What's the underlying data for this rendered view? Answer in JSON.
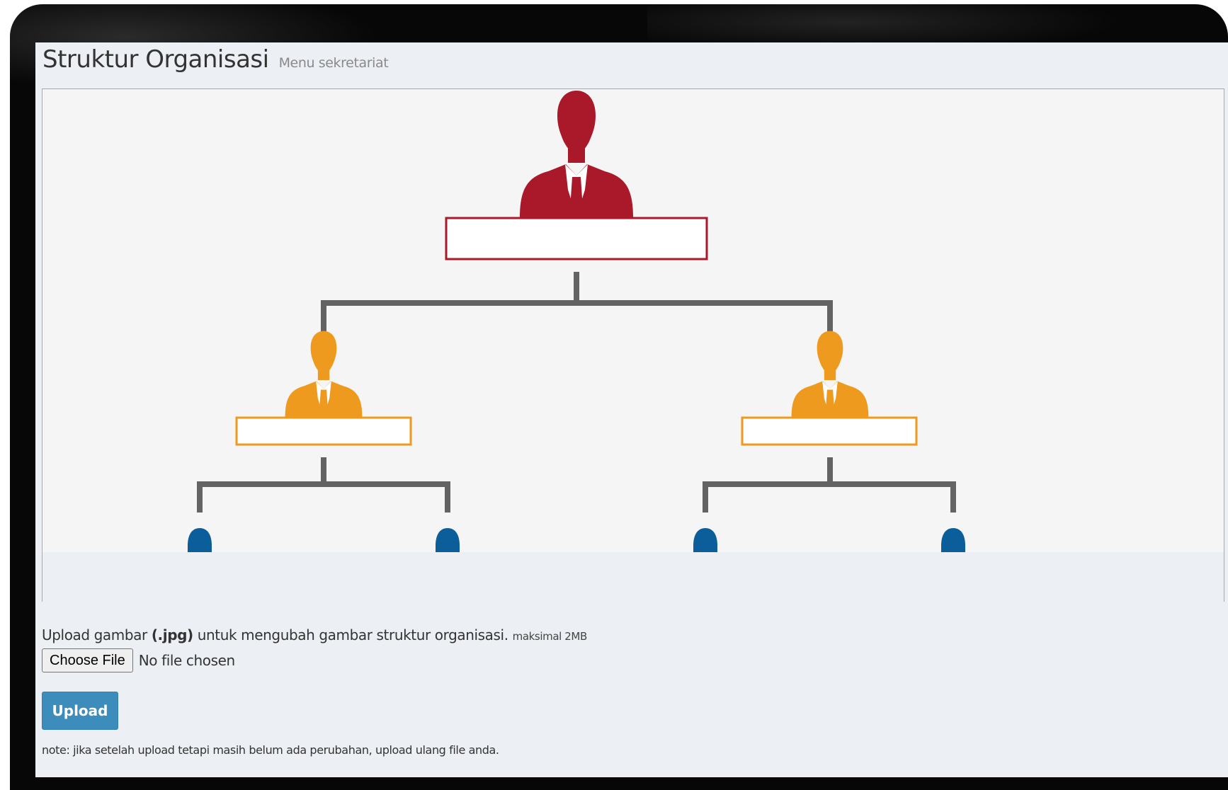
{
  "page": {
    "title": "Struktur Organisasi",
    "subtitle": "Menu sekretariat"
  },
  "org_chart": {
    "levels": [
      {
        "name": "top",
        "color": "#a9192a",
        "count": 1
      },
      {
        "name": "middle",
        "color": "#ee9a1e",
        "count": 2
      },
      {
        "name": "bottom",
        "color": "#0b5e99",
        "count": 4
      }
    ],
    "connector_color": "#636363"
  },
  "upload": {
    "text_before": "Upload gambar ",
    "format": "(.jpg)",
    "text_after": " untuk mengubah gambar struktur organisasi. ",
    "max_size": "maksimal 2MB",
    "choose_file_label": "Choose File",
    "file_status": "No file chosen",
    "upload_button": "Upload",
    "note": "note: jika setelah upload tetapi masih belum ada perubahan, upload ulang file anda."
  }
}
